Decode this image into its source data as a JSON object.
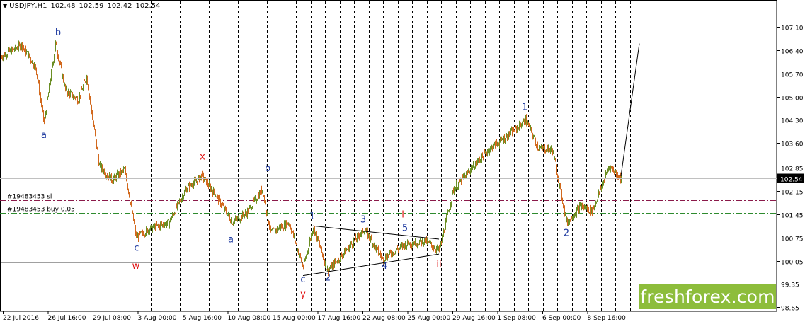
{
  "header": {
    "symbol": "USDJPY,H1",
    "ohlc": [
      "102.48",
      "102.59",
      "102.42",
      "102.54"
    ]
  },
  "current_price": "102.54",
  "brand": "freshforex.com",
  "colors": {
    "bull_candle": "#6b8e23",
    "bear_candle": "#d2691e",
    "grid": "#000000",
    "stop_line": "#8b1a4a",
    "buy_line": "#2e8b2e",
    "wave_blue": "#1e3aa0",
    "wave_red": "#e01010",
    "brand_bg": "#8dbd3b"
  },
  "chart_data": {
    "type": "candlestick",
    "symbol": "USDJPY",
    "timeframe": "H1",
    "y_axis": {
      "ticks": [
        "107.10",
        "106.40",
        "105.70",
        "105.00",
        "104.30",
        "103.60",
        "102.85",
        "102.15",
        "101.45",
        "100.75",
        "100.05",
        "99.35",
        "98.65"
      ],
      "range": [
        98.5,
        107.5
      ]
    },
    "x_axis": {
      "ticks": [
        "22 Jul 2016",
        "26 Jul 16:00",
        "29 Jul 08:00",
        "3 Aug 00:00",
        "5 Aug 16:00",
        "10 Aug 08:00",
        "15 Aug 00:00",
        "17 Aug 16:00",
        "22 Aug 08:00",
        "25 Aug 00:00",
        "29 Aug 16:00",
        "1 Sep 08:00",
        "6 Sep 00:00",
        "8 Sep 16:00"
      ]
    },
    "price_path": [
      {
        "t": 0,
        "p": 106.2
      },
      {
        "t": 30,
        "p": 106.55
      },
      {
        "t": 50,
        "p": 105.9
      },
      {
        "t": 62,
        "p": 104.2
      },
      {
        "t": 78,
        "p": 106.6
      },
      {
        "t": 92,
        "p": 105.2
      },
      {
        "t": 110,
        "p": 104.9
      },
      {
        "t": 122,
        "p": 105.6
      },
      {
        "t": 140,
        "p": 102.9
      },
      {
        "t": 158,
        "p": 102.5
      },
      {
        "t": 176,
        "p": 102.8
      },
      {
        "t": 192,
        "p": 100.75
      },
      {
        "t": 210,
        "p": 101.0
      },
      {
        "t": 238,
        "p": 101.2
      },
      {
        "t": 262,
        "p": 102.2
      },
      {
        "t": 285,
        "p": 102.6
      },
      {
        "t": 305,
        "p": 102.0
      },
      {
        "t": 328,
        "p": 101.2
      },
      {
        "t": 348,
        "p": 101.5
      },
      {
        "t": 370,
        "p": 102.2
      },
      {
        "t": 382,
        "p": 100.9
      },
      {
        "t": 408,
        "p": 101.2
      },
      {
        "t": 428,
        "p": 99.85
      },
      {
        "t": 442,
        "p": 101.1
      },
      {
        "t": 462,
        "p": 99.75
      },
      {
        "t": 488,
        "p": 100.35
      },
      {
        "t": 514,
        "p": 101.0
      },
      {
        "t": 540,
        "p": 100.1
      },
      {
        "t": 572,
        "p": 100.55
      },
      {
        "t": 600,
        "p": 100.65
      },
      {
        "t": 620,
        "p": 100.35
      },
      {
        "t": 640,
        "p": 102.2
      },
      {
        "t": 668,
        "p": 102.9
      },
      {
        "t": 690,
        "p": 103.4
      },
      {
        "t": 716,
        "p": 103.8
      },
      {
        "t": 742,
        "p": 104.3
      },
      {
        "t": 760,
        "p": 103.45
      },
      {
        "t": 780,
        "p": 103.4
      },
      {
        "t": 800,
        "p": 101.2
      },
      {
        "t": 820,
        "p": 101.7
      },
      {
        "t": 836,
        "p": 101.55
      },
      {
        "t": 860,
        "p": 102.9
      },
      {
        "t": 877,
        "p": 102.54
      }
    ],
    "levels": [
      {
        "label": "#19483453 sl",
        "price": 101.88,
        "style": "dash-dot",
        "color": "#8b1a4a"
      },
      {
        "label": "#19483453 buy 0.05",
        "price": 101.5,
        "style": "dash-dot",
        "color": "#2e8b2e"
      }
    ],
    "trendlines": [
      {
        "from": [
          "t0",
          100.0
        ],
        "to": [
          "t428",
          100.0
        ]
      },
      {
        "from": [
          "t428",
          99.6
        ],
        "to": [
          "t620",
          100.25
        ]
      },
      {
        "from": [
          "t442",
          101.1
        ],
        "to": [
          "t620",
          100.7
        ]
      },
      {
        "from": [
          "t877",
          102.6
        ],
        "to": [
          "t903",
          106.6
        ]
      }
    ],
    "wave_labels": [
      {
        "text": "b",
        "t": 82,
        "p": 106.85,
        "color": "blue"
      },
      {
        "text": "a",
        "t": 62,
        "p": 103.75,
        "color": "blue"
      },
      {
        "text": "x",
        "t": 286,
        "p": 103.1,
        "color": "red"
      },
      {
        "text": "b",
        "t": 378,
        "p": 102.75,
        "color": "blue"
      },
      {
        "text": "c",
        "t": 193,
        "p": 100.35,
        "color": "blue"
      },
      {
        "text": "w",
        "t": 192,
        "p": 99.8,
        "color": "red"
      },
      {
        "text": "a",
        "t": 326,
        "p": 100.6,
        "color": "blue"
      },
      {
        "text": "1",
        "t": 441,
        "p": 101.3,
        "color": "blue"
      },
      {
        "text": "3",
        "t": 513,
        "p": 101.2,
        "color": "blue"
      },
      {
        "text": "i",
        "t": 569,
        "p": 101.35,
        "color": "red"
      },
      {
        "text": "5",
        "t": 572,
        "p": 100.95,
        "color": "blue"
      },
      {
        "text": "4",
        "t": 543,
        "p": 99.8,
        "color": "blue"
      },
      {
        "text": "2",
        "t": 463,
        "p": 99.45,
        "color": "blue"
      },
      {
        "text": "c",
        "t": 428,
        "p": 99.4,
        "color": "blue"
      },
      {
        "text": "y",
        "t": 428,
        "p": 98.95,
        "color": "red"
      },
      {
        "text": "ii",
        "t": 620,
        "p": 99.85,
        "color": "red"
      },
      {
        "text": "1",
        "t": 741,
        "p": 104.6,
        "color": "blue"
      },
      {
        "text": "2",
        "t": 800,
        "p": 100.8,
        "color": "blue"
      }
    ]
  }
}
